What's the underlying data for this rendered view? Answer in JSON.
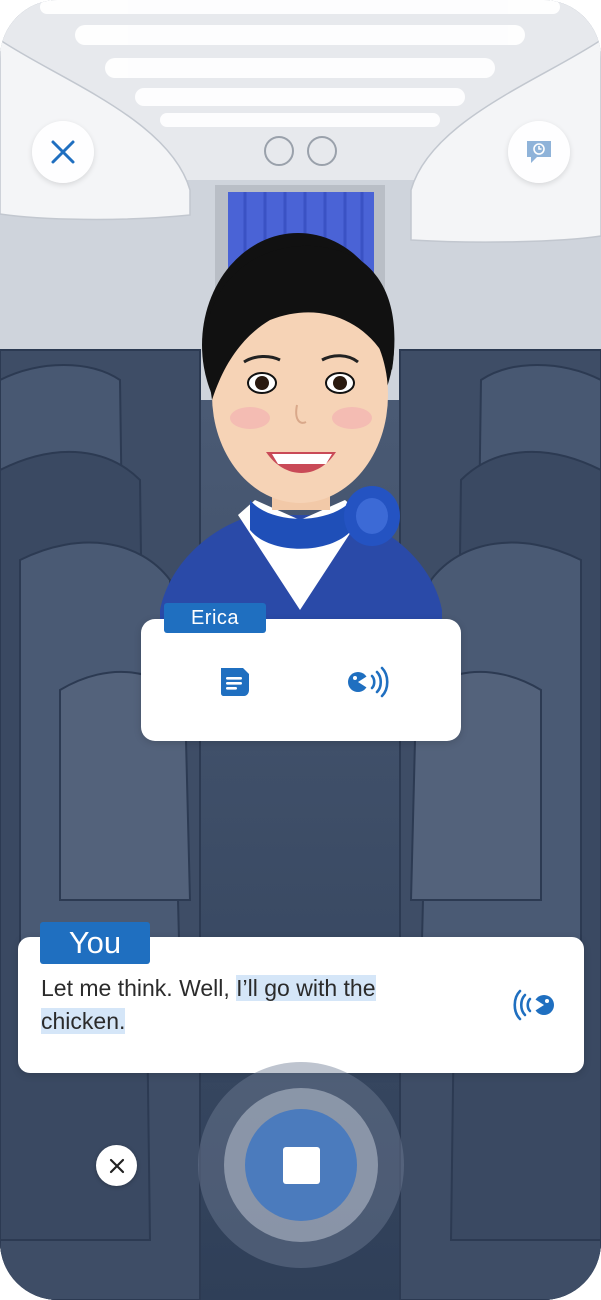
{
  "npc": {
    "name": "Erica",
    "icons": {
      "transcript": "message-text-icon",
      "audio": "speaker-play-icon"
    }
  },
  "user": {
    "tag": "You",
    "message_plain": "Let me think. Well, ",
    "message_highlight_1": "I’ll go with the",
    "message_highlight_2": "chicken.",
    "icons": {
      "audio": "speaker-play-icon"
    }
  },
  "controls": {
    "close_icon": "close-icon",
    "history_icon": "chat-history-icon",
    "cancel_icon": "cancel-x-icon",
    "record_icon": "stop-icon"
  },
  "colors": {
    "accent": "#1f6fc0",
    "record_button": "#4b7bbd",
    "highlight": "#d5e6f8",
    "seat_navy": "#33435c"
  }
}
